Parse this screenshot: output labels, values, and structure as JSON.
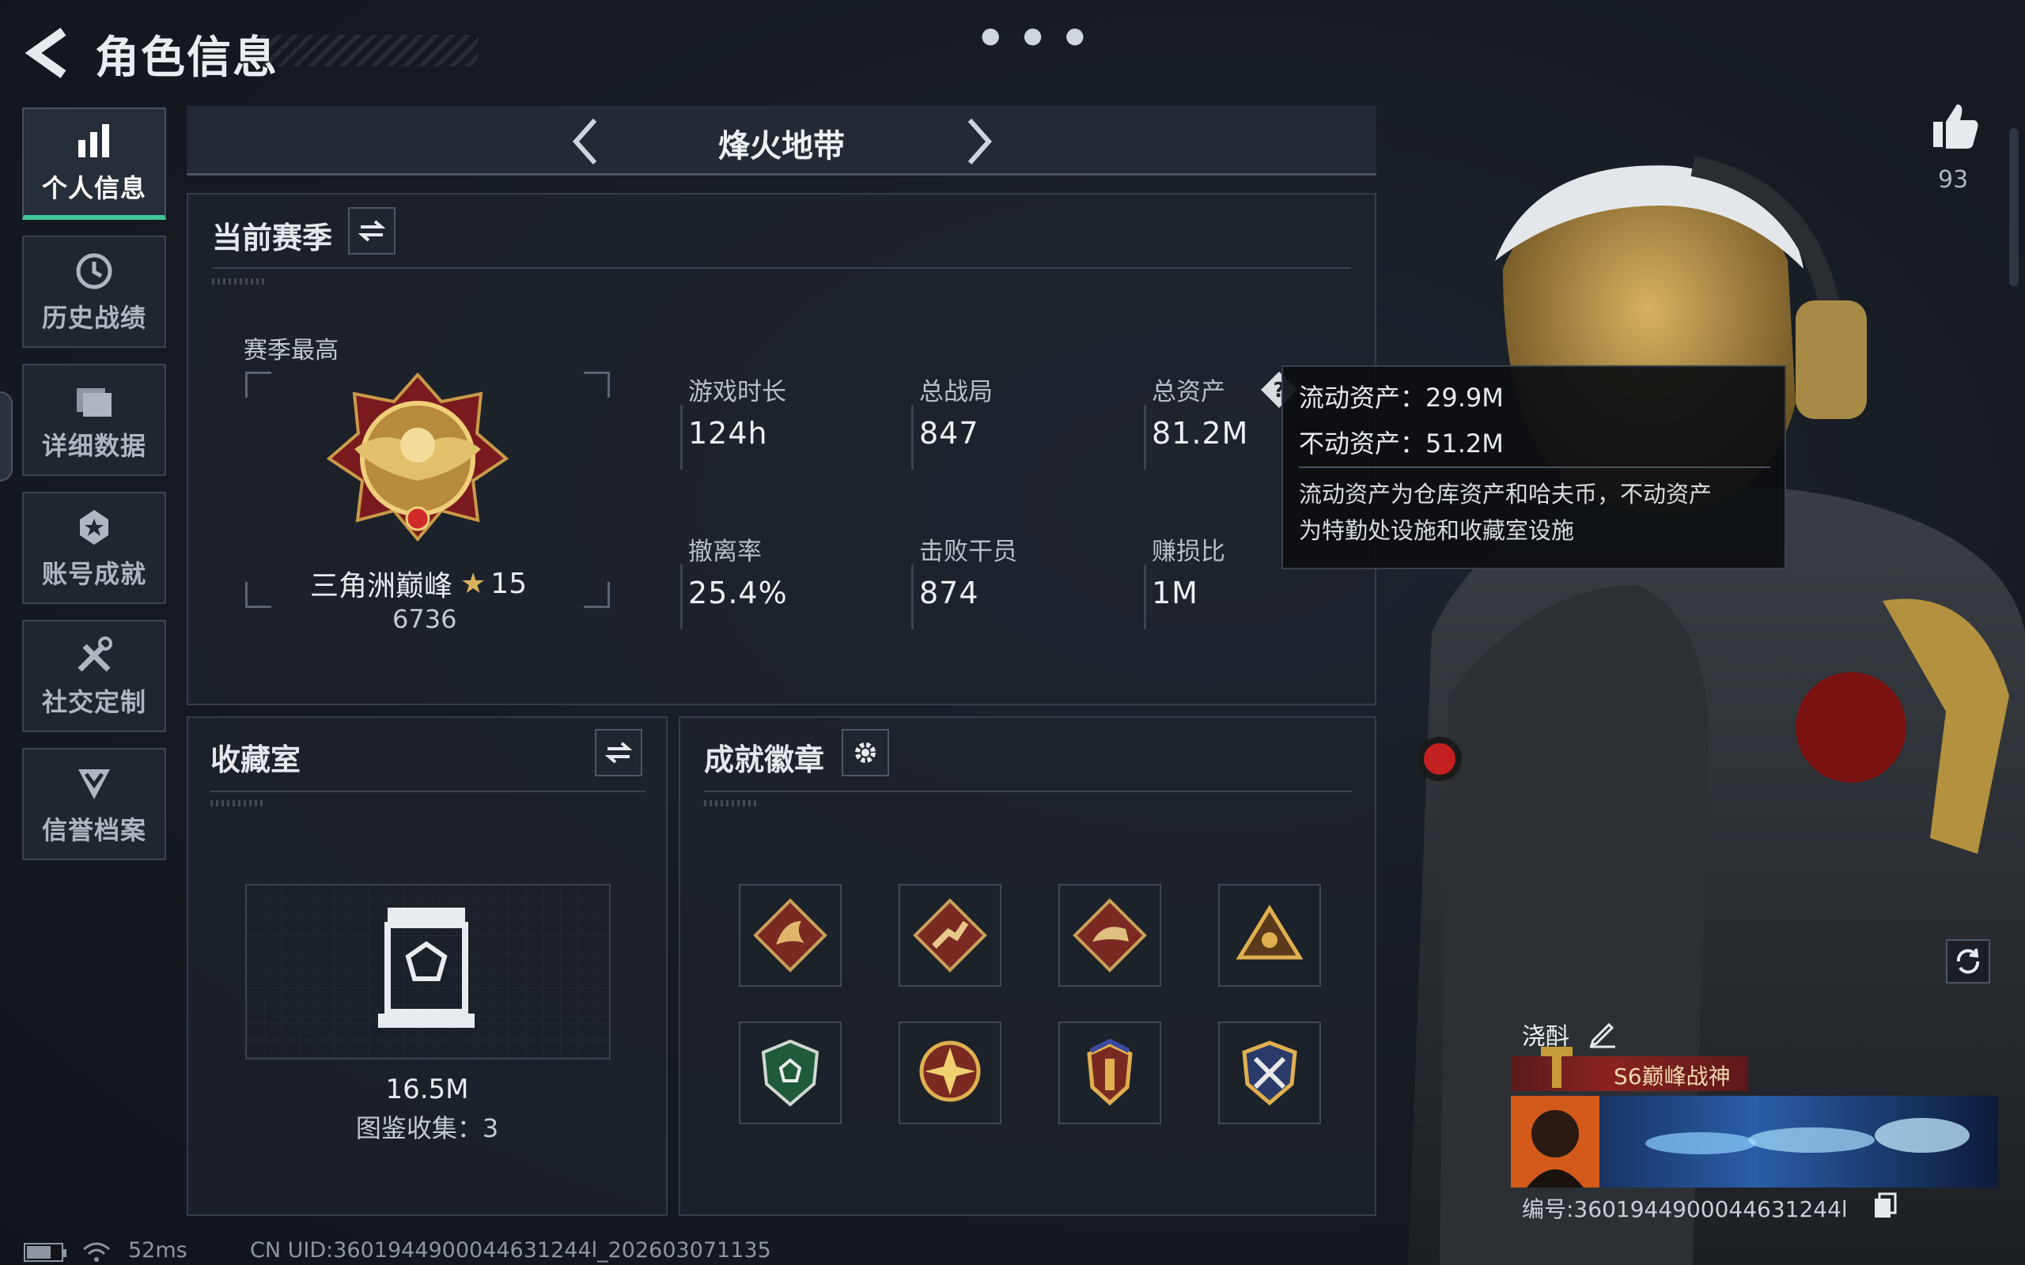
{
  "header": {
    "title": "角色信息",
    "more_icon": "more-dots-icon"
  },
  "nav": [
    {
      "label": "个人信息",
      "icon": "bar-chart-icon",
      "active": true
    },
    {
      "label": "历史战绩",
      "icon": "history-clock-icon",
      "active": false
    },
    {
      "label": "详细数据",
      "icon": "folder-icon",
      "active": false
    },
    {
      "label": "账号成就",
      "icon": "medal-star-icon",
      "active": false
    },
    {
      "label": "社交定制",
      "icon": "tools-icon",
      "active": false
    },
    {
      "label": "信誉档案",
      "icon": "shield-chevron-icon",
      "active": false
    }
  ],
  "mode": {
    "title": "烽火地带"
  },
  "season": {
    "title": "当前赛季",
    "best_label": "赛季最高",
    "rank_name": "三角洲巅峰",
    "rank_stars": "15",
    "rank_score": "6736",
    "stats": [
      {
        "label": "游戏时长",
        "value": "124h"
      },
      {
        "label": "总战局",
        "value": "847"
      },
      {
        "label": "总资产",
        "value": "81.2M"
      },
      {
        "label": "撤离率",
        "value": "25.4%"
      },
      {
        "label": "击败干员",
        "value": "874"
      },
      {
        "label": "赚损比",
        "value": "1M"
      }
    ]
  },
  "tooltip": {
    "liquid": "流动资产：29.9M",
    "fixed": "不动资产：51.2M",
    "desc_line1": "流动资产为仓库资产和哈夫币，不动资产",
    "desc_line2": "为特勤处设施和收藏室设施"
  },
  "collection": {
    "title": "收藏室",
    "value": "16.5M",
    "count_text": "图鉴收集：3"
  },
  "badges": {
    "title": "成就徽章",
    "items": [
      "dragon-badge",
      "runner-badge",
      "crocodile-badge",
      "triangle-badge",
      "green-shield-badge",
      "star-compass-badge",
      "winged-shield-badge",
      "sword-shield-badge"
    ]
  },
  "player": {
    "like_count": "93",
    "name": "浇酙",
    "title": "S6巅峰战神",
    "uid": "编号:3601944900044631244l"
  },
  "status": {
    "ping": "52ms",
    "uid_line": "CN UID:3601944900044631244l_202603071135"
  },
  "colors": {
    "accent_green": "#3fc79a",
    "gold": "#d8b25a",
    "title_red": "#8a2323"
  }
}
